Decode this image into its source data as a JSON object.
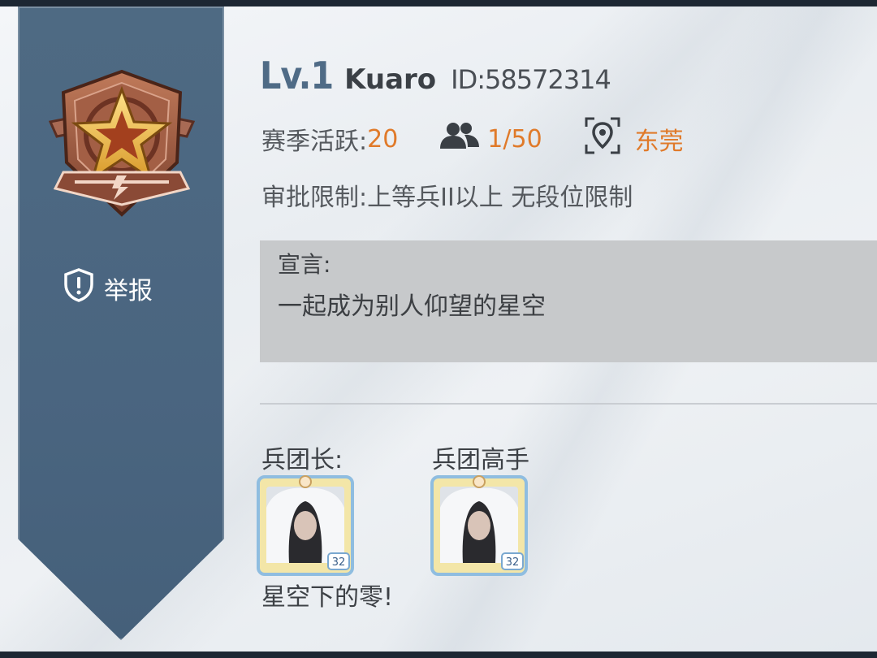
{
  "profile": {
    "level": "Lv.1",
    "name": "Kuaro",
    "id_text": "ID:58572314"
  },
  "stats": {
    "season_label": "赛季活跃:",
    "season_value": "20",
    "members_value": "1/50",
    "location": "东莞"
  },
  "approval": {
    "text": "审批限制:上等兵II以上  无段位限制"
  },
  "declaration": {
    "label": "宣言:",
    "text": "一起成为别人仰望的星空"
  },
  "sidebar": {
    "report_label": "举报"
  },
  "roles": {
    "leader_label": "兵团长:",
    "expert_label": "兵团高手",
    "leader_name": "星空下的零!",
    "leader_avatar_level": "32",
    "expert_avatar_level": "32"
  },
  "icons": {
    "rank_badge": "star-shield-badge-icon",
    "report": "shield-alert-icon",
    "members": "people-icon",
    "location": "location-pin-icon"
  },
  "colors": {
    "accent_orange": "#e07a2a",
    "level_blue": "#4f6b86",
    "sidebar_blue": "#4a6580"
  }
}
